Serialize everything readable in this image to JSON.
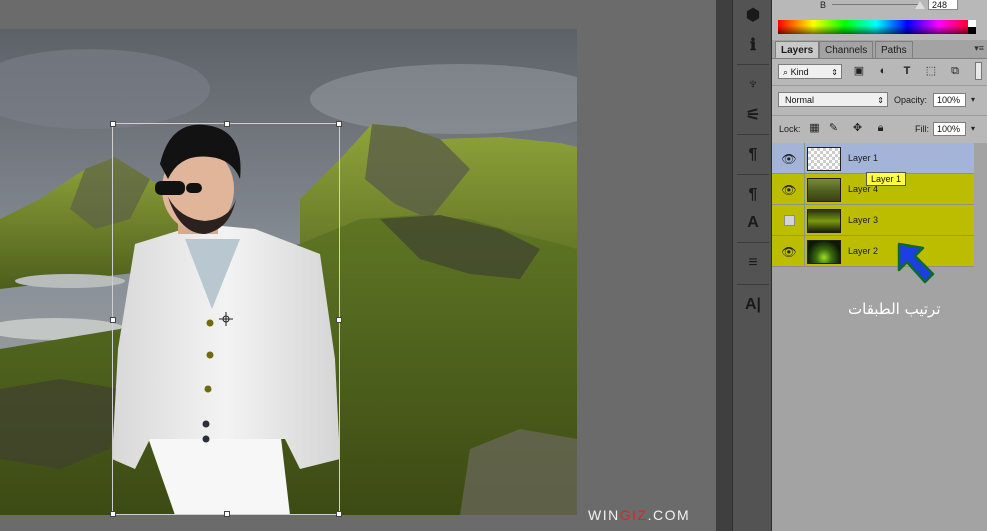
{
  "canvas": {
    "watermark_prefix": "WIN",
    "watermark_highlight": "GIZ",
    "watermark_suffix": ".COM"
  },
  "tools": [
    {
      "name": "cube-3d-icon",
      "glyph": "⬢"
    },
    {
      "name": "info-icon",
      "glyph": "ℹ"
    },
    {
      "name": "brush-presets-icon",
      "glyph": "♆"
    },
    {
      "name": "adjustments-icon",
      "glyph": "⚟"
    },
    {
      "name": "paragraph-icon",
      "glyph": "¶"
    },
    {
      "name": "paragraph-styles-icon",
      "glyph": "¶"
    },
    {
      "name": "character-styles-icon",
      "glyph": "A"
    },
    {
      "name": "glyphs-icon",
      "glyph": "≡"
    },
    {
      "name": "character-icon",
      "glyph": "A|"
    }
  ],
  "color_panel": {
    "channel_label": "B",
    "channel_value": "248"
  },
  "layers_panel": {
    "tabs": [
      {
        "label": "Layers",
        "active": true
      },
      {
        "label": "Channels",
        "active": false
      },
      {
        "label": "Paths",
        "active": false
      }
    ],
    "menu_glyph": "▾≡",
    "filter_kind": "Kind",
    "filter_search_glyph": "⌕",
    "blend_mode": "Normal",
    "opacity_label": "Opacity:",
    "opacity_value": "100%",
    "lock_label": "Lock:",
    "fill_label": "Fill:",
    "fill_value": "100%",
    "layers": [
      {
        "name": "Layer 1",
        "visible": true,
        "selected": true,
        "highlighted": false
      },
      {
        "name": "Layer 4",
        "visible": true,
        "selected": false,
        "highlighted": true
      },
      {
        "name": "Layer 3",
        "visible": false,
        "selected": false,
        "highlighted": true
      },
      {
        "name": "Layer 2",
        "visible": true,
        "selected": false,
        "highlighted": true
      }
    ],
    "tooltip": "Layer 1"
  },
  "annotation": {
    "caption": "ترتيب الطبقات"
  }
}
